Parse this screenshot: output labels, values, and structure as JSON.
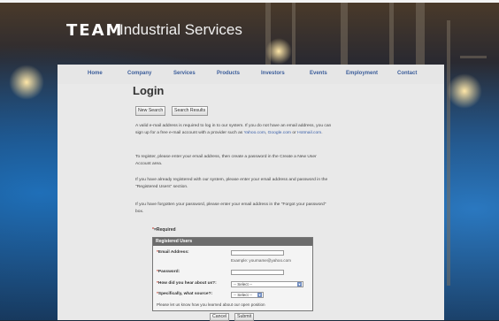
{
  "logo": {
    "team": "TEAM",
    "services": "Industrial Services"
  },
  "nav": [
    {
      "label": "Home"
    },
    {
      "label": "Company"
    },
    {
      "label": "Services"
    },
    {
      "label": "Products"
    },
    {
      "label": "Investors"
    },
    {
      "label": "Events"
    },
    {
      "label": "Employment"
    },
    {
      "label": "Contact"
    }
  ],
  "page": {
    "title": "Login"
  },
  "buttons": {
    "new_search": "New Search",
    "search_results": "Search Results",
    "cancel": "Cancel",
    "submit": "Submit"
  },
  "intro": {
    "p1_text": "A valid e-mail address is required to log in to our system. If you do not have an email address, you can sign up for a free e-mail account with a provider such as ",
    "p1_link1": "Yahoo.com",
    "p1_sep1": ", ",
    "p1_link2": "Google.com",
    "p1_sep2": " or ",
    "p1_link3": "Hotmail.com",
    "p1_end": ".",
    "p2": "To register, please enter your email address, then create a password in the Create a New User Account area.",
    "p3": "If you have already registered with our system, please enter your email address and password in the \"Registered Users\" section.",
    "p4": "If you have forgotten your password, please enter your email address in the \"Forgot your password\" box."
  },
  "form": {
    "required_mark": "*",
    "required_label": "=Required",
    "header": "Registered Users",
    "email_label": "Email Address:",
    "email_value": "",
    "email_hint": "Example: yourname@yahoo.com",
    "password_label": "Password:",
    "password_value": "",
    "hear_label": "How did you hear about us?:",
    "hear_selected": "-- Select --",
    "source_label": "Specifically, what source?:",
    "source_selected": "-- Select --",
    "note": "Please let us know how you learned about our open position"
  },
  "colors": {
    "nav_link": "#3b5d9a",
    "link": "#3a5fa8",
    "required": "#c0392b",
    "form_header": "#6c6c6c"
  }
}
